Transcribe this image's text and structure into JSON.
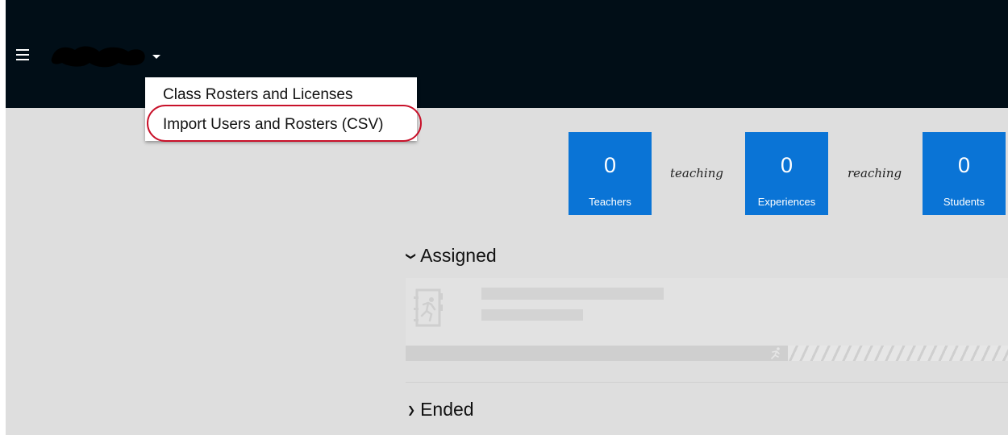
{
  "header": {
    "menu_icon": "menu-icon",
    "account_name": "",
    "account_menu_icon": "caret-down-icon"
  },
  "dropdown": {
    "items": [
      {
        "label": "Class Rosters and Licenses"
      },
      {
        "label": "Import Users and Rosters (CSV)",
        "highlighted": true
      }
    ]
  },
  "stats": {
    "teachers": {
      "value": "0",
      "label": "Teachers"
    },
    "connector1": "teaching",
    "experiences": {
      "value": "0",
      "label": "Experiences"
    },
    "connector2": "reaching",
    "students": {
      "value": "0",
      "label": "Students"
    }
  },
  "sections": {
    "assigned": {
      "label": "Assigned",
      "chevron": "chevron-down-icon"
    },
    "ended": {
      "label": "Ended",
      "chevron": "chevron-right-icon"
    }
  },
  "colors": {
    "topbar": "#010e17",
    "accent": "#0a74d6",
    "highlight": "#c8112a",
    "background": "#dedede"
  }
}
